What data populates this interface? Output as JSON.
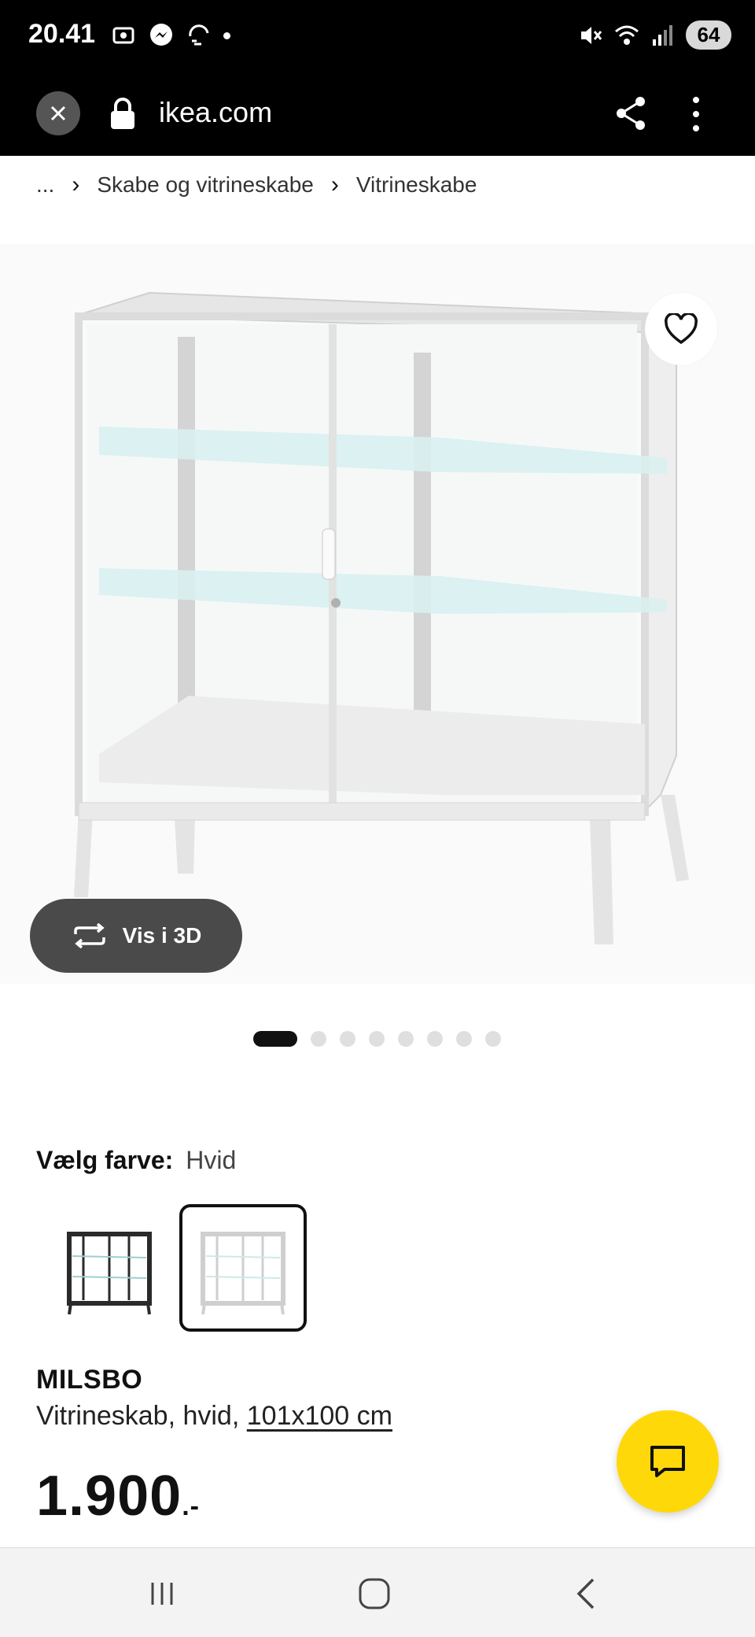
{
  "status_bar": {
    "time": "20.41",
    "battery": "64",
    "icons": [
      "screenshot-icon",
      "messenger-icon",
      "sync-icon",
      "notification-dot",
      "mute-icon",
      "wifi-icon",
      "signal-icon",
      "battery-icon"
    ]
  },
  "browser": {
    "url": "ikea.com",
    "close_icon": "close-icon",
    "lock_icon": "lock-icon",
    "share_icon": "share-icon",
    "menu_icon": "more-vert-icon"
  },
  "breadcrumb": {
    "items": [
      "...",
      "Skabe og vitrineskabe",
      "Vitrineskabe"
    ],
    "separator": "›"
  },
  "gallery": {
    "favorite_icon": "heart-icon",
    "view_3d_label": "Vis i 3D",
    "view_3d_icon": "rotate-3d-icon",
    "total_images": 8,
    "active_image_index": 0
  },
  "color_picker": {
    "label": "Vælg farve:",
    "selected_value": "Hvid",
    "options": [
      {
        "name": "black",
        "selected": false
      },
      {
        "name": "white",
        "selected": true
      }
    ]
  },
  "product": {
    "name": "MILSBO",
    "description": "Vitrineskab, hvid,",
    "size": "101x100 cm",
    "price": "1.900",
    "price_suffix": ".-"
  },
  "chat": {
    "icon": "chat-icon"
  },
  "nav_bar": {
    "icons": [
      "recent-apps-icon",
      "home-icon",
      "back-icon"
    ]
  },
  "colors": {
    "accent_yellow": "#ffd80a",
    "button_dark": "#4a4a4a",
    "status_bg": "#000000"
  }
}
